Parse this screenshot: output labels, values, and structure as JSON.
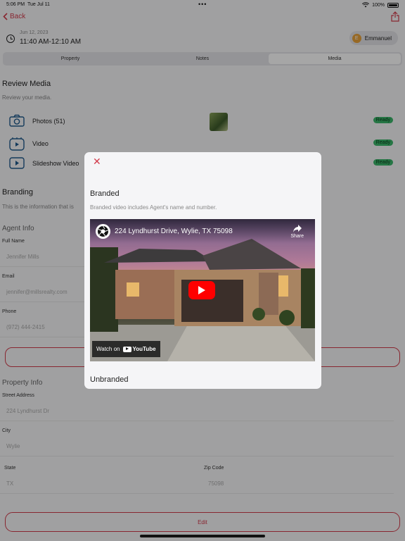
{
  "status_bar": {
    "time": "5:06 PM",
    "date": "Tue Jul 11",
    "dots": "•••",
    "battery": "100%"
  },
  "nav": {
    "back_label": "Back"
  },
  "appointment": {
    "date": "Jun 12, 2023",
    "time_range": "11:40 AM-12:10 AM",
    "user_initial": "E",
    "user_name": "Emmanuel"
  },
  "tabs": [
    {
      "label": "Property",
      "active": false
    },
    {
      "label": "Notes",
      "active": false
    },
    {
      "label": "Media",
      "active": true
    }
  ],
  "review_media": {
    "title": "Review Media",
    "subtitle": "Review your media.",
    "items": [
      {
        "label": "Photos (51)",
        "status": "Ready",
        "icon": "camera-icon"
      },
      {
        "label": "Video",
        "status": "Ready",
        "icon": "video-icon"
      },
      {
        "label": "Slideshow Video",
        "status": "Ready",
        "icon": "slideshow-icon"
      }
    ]
  },
  "branding": {
    "title": "Branding",
    "subtitle": "This is the information that is"
  },
  "agent_info": {
    "title": "Agent Info",
    "full_name_label": "Full Name",
    "full_name_value": "Jennifer Mills",
    "email_label": "Email",
    "email_value": "jennifer@millsrealty.com",
    "phone_label": "Phone",
    "phone_value": "(972) 444-2415"
  },
  "property_info": {
    "title": "Property Info",
    "street_label": "Street Address",
    "street_value": "224 Lyndhurst Dr",
    "city_label": "City",
    "city_value": "Wylie",
    "state_label": "State",
    "state_value": "TX",
    "zip_label": "Zip Code",
    "zip_value": "75098"
  },
  "edit_label": "Edit",
  "modal": {
    "close": "✕",
    "branded_title": "Branded",
    "branded_desc": "Branded video includes Agent's name and number.",
    "unbranded_title": "Unbranded",
    "video": {
      "title": "224 Lyndhurst Drive, Wylie, TX 75098",
      "share_label": "Share",
      "watch_on": "Watch on",
      "youtube": "YouTube"
    }
  },
  "colors": {
    "accent": "#d23b4b",
    "ready_badge": "#3bb56a"
  }
}
